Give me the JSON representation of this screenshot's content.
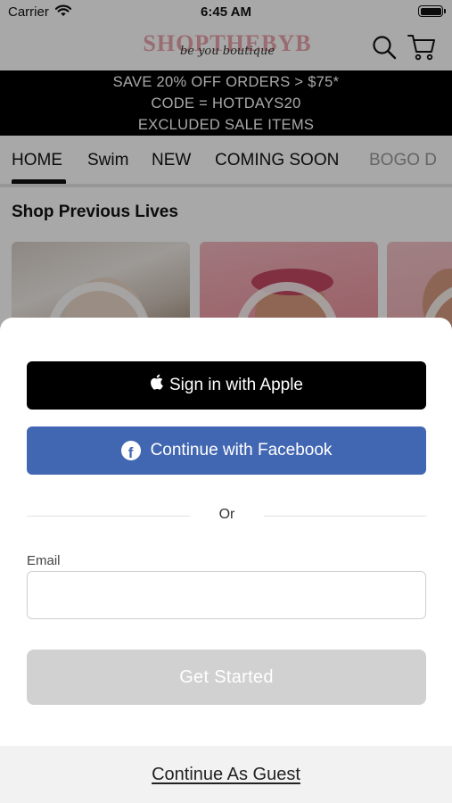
{
  "status_bar": {
    "carrier": "Carrier",
    "time": "6:45 AM"
  },
  "header": {
    "logo_main": "SHOPTHEBYB",
    "logo_script": "be you boutique"
  },
  "promo": {
    "line1": "SAVE 20% OFF ORDERS > $75*",
    "line2": "CODE = HOTDAYS20",
    "line3": "EXCLUDED SALE ITEMS"
  },
  "tabs": [
    {
      "label": "HOME",
      "selected": true
    },
    {
      "label": "Swim"
    },
    {
      "label": "NEW"
    },
    {
      "label": "COMING SOON"
    },
    {
      "label": "BOGO D"
    }
  ],
  "section_title": "Shop Previous Lives",
  "sheet": {
    "apple_label": "Sign in with Apple",
    "facebook_label": "Continue with Facebook",
    "or_label": "Or",
    "email_label": "Email",
    "email_value": "",
    "email_placeholder": "",
    "start_label": "Get Started",
    "guest_label": "Continue As Guest"
  },
  "colors": {
    "facebook": "#4267b2",
    "apple": "#000000",
    "disabled_button": "#d1d1d1",
    "promo_bg": "#000000"
  },
  "icons": [
    "wifi-icon",
    "battery-icon",
    "search-icon",
    "cart-icon",
    "apple-icon",
    "facebook-icon"
  ]
}
